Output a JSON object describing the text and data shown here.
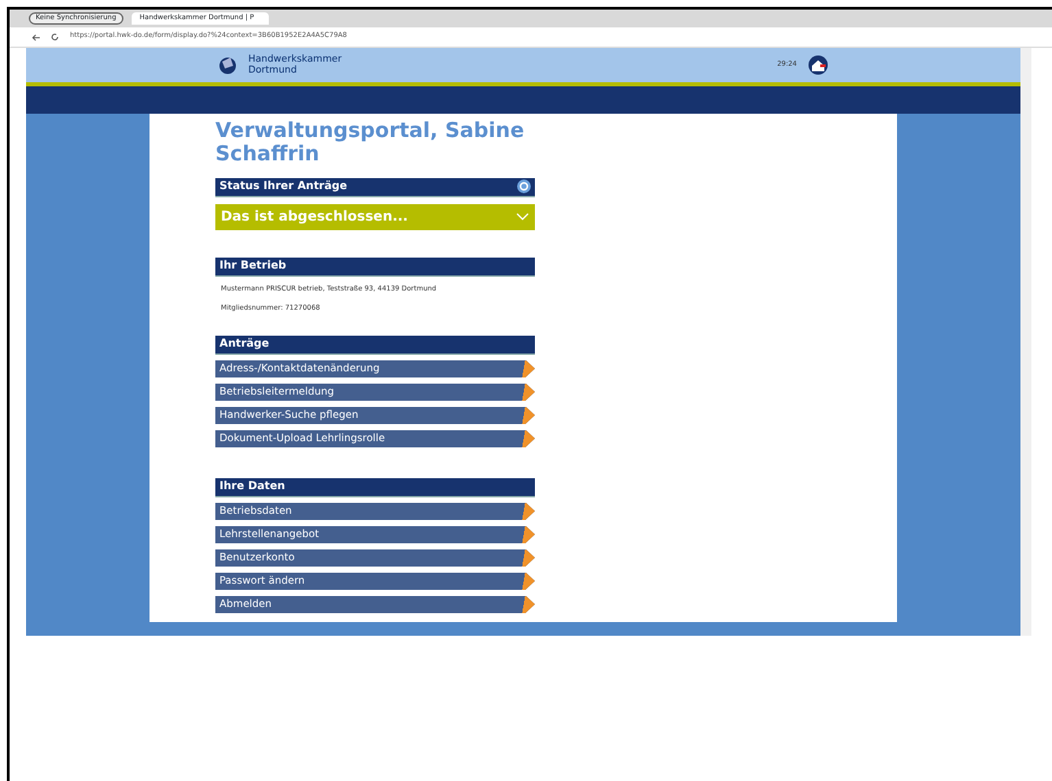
{
  "browser": {
    "profile": "Keine Synchronisierung",
    "tab_title": "Handwerkskammer Dortmund | P",
    "url": "https://portal.hwk-do.de/form/display.do?%24context=3B60B1952E2A4A5C79A8"
  },
  "header": {
    "org_line1": "Handwerkskammer",
    "org_line2": "Dortmund",
    "timer": "29:24"
  },
  "title": "Verwaltungsportal, Sabine Schaffrin",
  "status": {
    "heading": "Status Ihrer Anträge",
    "summary": "Das ist abgeschlossen...",
    "expanded": false
  },
  "betrieb": {
    "heading": "Ihr Betrieb",
    "lines": [
      "Mustermann PRISCUR betrieb, Teststraße 93, 44139 Dortmund",
      "Mitgliedsnummer: 71270068"
    ]
  },
  "sections": [
    {
      "heading": "Anträge",
      "items": [
        "Adress-/Kontaktdatenänderung",
        "Betriebsleitermeldung",
        "Handwerker-Suche pflegen",
        "Dokument-Upload Lehrlingsrolle"
      ]
    },
    {
      "heading": "Ihre Daten",
      "items": [
        "Betriebsdaten",
        "Lehrstellenangebot",
        "Benutzerkonto",
        "Passwort ändern",
        "Abmelden"
      ]
    }
  ]
}
